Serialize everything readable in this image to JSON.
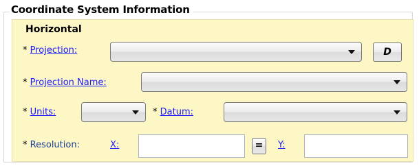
{
  "group": {
    "title": "Coordinate System Information"
  },
  "horizontal": {
    "title": "Horizontal",
    "projection": {
      "required_mark": "*",
      "label": "Projection:",
      "selected": "",
      "details_button": "D"
    },
    "projection_name": {
      "required_mark": "*",
      "label": "Projection Name:",
      "selected": ""
    },
    "units": {
      "required_mark": "*",
      "label": "Units:",
      "selected": ""
    },
    "datum": {
      "required_mark": "*",
      "label": "Datum:",
      "selected": ""
    },
    "resolution": {
      "required_mark": "*",
      "label": "Resolution:",
      "x_label": "X:",
      "x_value": "",
      "equal_button": "=",
      "y_label": "Y:",
      "y_value": ""
    }
  }
}
